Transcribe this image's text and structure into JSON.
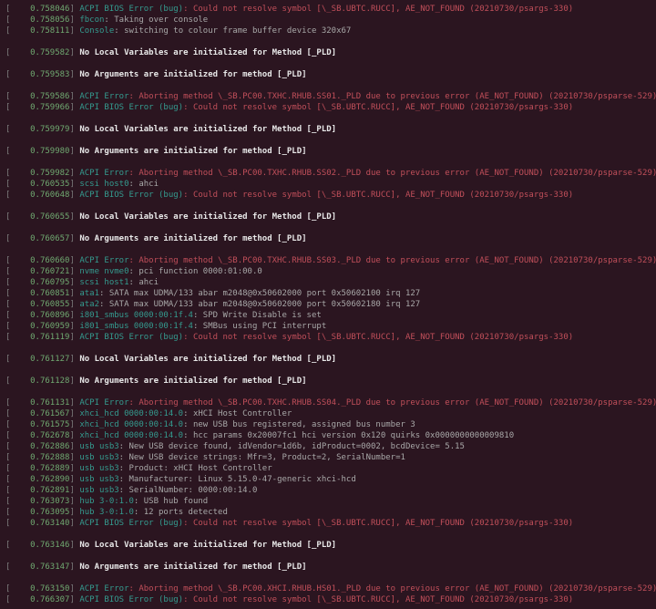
{
  "lines": [
    {
      "ts": "0.758046",
      "src": "ACPI BIOS Error (bug)",
      "err": ": Could not resolve symbol [\\_SB.UBTC.RUCC], AE_NOT_FOUND (20210730/psargs-330)"
    },
    {
      "ts": "0.758056",
      "src": "fbcon",
      "msg": ": Taking over console"
    },
    {
      "ts": "0.758111",
      "src": "Console",
      "msg": ": switching to colour frame buffer device 320x67"
    },
    {
      "blank": true
    },
    {
      "ts": "0.759582",
      "white": "No Local Variables are initialized for Method [_PLD]"
    },
    {
      "blank": true
    },
    {
      "ts": "0.759583",
      "white": "No Arguments are initialized for method [_PLD]"
    },
    {
      "blank": true
    },
    {
      "ts": "0.759586",
      "src": "ACPI Error",
      "err": ": Aborting method \\_SB.PC00.TXHC.RHUB.SS01._PLD due to previous error (AE_NOT_FOUND) (20210730/psparse-529)"
    },
    {
      "ts": "0.759966",
      "src": "ACPI BIOS Error (bug)",
      "err": ": Could not resolve symbol [\\_SB.UBTC.RUCC], AE_NOT_FOUND (20210730/psargs-330)"
    },
    {
      "blank": true
    },
    {
      "ts": "0.759979",
      "white": "No Local Variables are initialized for Method [_PLD]"
    },
    {
      "blank": true
    },
    {
      "ts": "0.759980",
      "white": "No Arguments are initialized for method [_PLD]"
    },
    {
      "blank": true
    },
    {
      "ts": "0.759982",
      "src": "ACPI Error",
      "err": ": Aborting method \\_SB.PC00.TXHC.RHUB.SS02._PLD due to previous error (AE_NOT_FOUND) (20210730/psparse-529)"
    },
    {
      "ts": "0.760535",
      "src": "scsi host0",
      "msg": ": ahci"
    },
    {
      "ts": "0.760648",
      "src": "ACPI BIOS Error (bug)",
      "err": ": Could not resolve symbol [\\_SB.UBTC.RUCC], AE_NOT_FOUND (20210730/psargs-330)"
    },
    {
      "blank": true
    },
    {
      "ts": "0.760655",
      "white": "No Local Variables are initialized for Method [_PLD]"
    },
    {
      "blank": true
    },
    {
      "ts": "0.760657",
      "white": "No Arguments are initialized for method [_PLD]"
    },
    {
      "blank": true
    },
    {
      "ts": "0.760660",
      "src": "ACPI Error",
      "err": ": Aborting method \\_SB.PC00.TXHC.RHUB.SS03._PLD due to previous error (AE_NOT_FOUND) (20210730/psparse-529)"
    },
    {
      "ts": "0.760721",
      "src": "nvme nvme0",
      "msg": ": pci function 0000:01:00.0"
    },
    {
      "ts": "0.760795",
      "src": "scsi host1",
      "msg": ": ahci"
    },
    {
      "ts": "0.760851",
      "src": "ata1",
      "msg": ": SATA max UDMA/133 abar m2048@0x50602000 port 0x50602100 irq 127"
    },
    {
      "ts": "0.760855",
      "src": "ata2",
      "msg": ": SATA max UDMA/133 abar m2048@0x50602000 port 0x50602180 irq 127"
    },
    {
      "ts": "0.760896",
      "src": "i801_smbus 0000:00:1f.4",
      "msg": ": SPD Write Disable is set"
    },
    {
      "ts": "0.760959",
      "src": "i801_smbus 0000:00:1f.4",
      "msg": ": SMBus using PCI interrupt"
    },
    {
      "ts": "0.761119",
      "src": "ACPI BIOS Error (bug)",
      "err": ": Could not resolve symbol [\\_SB.UBTC.RUCC], AE_NOT_FOUND (20210730/psargs-330)"
    },
    {
      "blank": true
    },
    {
      "ts": "0.761127",
      "white": "No Local Variables are initialized for Method [_PLD]"
    },
    {
      "blank": true
    },
    {
      "ts": "0.761128",
      "white": "No Arguments are initialized for method [_PLD]"
    },
    {
      "blank": true
    },
    {
      "ts": "0.761131",
      "src": "ACPI Error",
      "err": ": Aborting method \\_SB.PC00.TXHC.RHUB.SS04._PLD due to previous error (AE_NOT_FOUND) (20210730/psparse-529)"
    },
    {
      "ts": "0.761567",
      "src": "xhci_hcd 0000:00:14.0",
      "msg": ": xHCI Host Controller"
    },
    {
      "ts": "0.761575",
      "src": "xhci_hcd 0000:00:14.0",
      "msg": ": new USB bus registered, assigned bus number 3"
    },
    {
      "ts": "0.762678",
      "src": "xhci_hcd 0000:00:14.0",
      "msg": ": hcc params 0x20007fc1 hci version 0x120 quirks 0x0000000000009810"
    },
    {
      "ts": "0.762886",
      "src": "usb usb3",
      "msg": ": New USB device found, idVendor=1d6b, idProduct=0002, bcdDevice= 5.15"
    },
    {
      "ts": "0.762888",
      "src": "usb usb3",
      "msg": ": New USB device strings: Mfr=3, Product=2, SerialNumber=1"
    },
    {
      "ts": "0.762889",
      "src": "usb usb3",
      "msg": ": Product: xHCI Host Controller"
    },
    {
      "ts": "0.762890",
      "src": "usb usb3",
      "msg": ": Manufacturer: Linux 5.15.0-47-generic xhci-hcd"
    },
    {
      "ts": "0.762891",
      "src": "usb usb3",
      "msg": ": SerialNumber: 0000:00:14.0"
    },
    {
      "ts": "0.763073",
      "src": "hub 3-0:1.0",
      "msg": ": USB hub found"
    },
    {
      "ts": "0.763095",
      "src": "hub 3-0:1.0",
      "msg": ": 12 ports detected"
    },
    {
      "ts": "0.763140",
      "src": "ACPI BIOS Error (bug)",
      "err": ": Could not resolve symbol [\\_SB.UBTC.RUCC], AE_NOT_FOUND (20210730/psargs-330)"
    },
    {
      "blank": true
    },
    {
      "ts": "0.763146",
      "white": "No Local Variables are initialized for Method [_PLD]"
    },
    {
      "blank": true
    },
    {
      "ts": "0.763147",
      "white": "No Arguments are initialized for method [_PLD]"
    },
    {
      "blank": true
    },
    {
      "ts": "0.763150",
      "src": "ACPI Error",
      "err": ": Aborting method \\_SB.PC00.XHCI.RHUB.HS01._PLD due to previous error (AE_NOT_FOUND) (20210730/psparse-529)"
    },
    {
      "ts": "0.766307",
      "src": "ACPI BIOS Error (bug)",
      "err": ": Could not resolve symbol [\\_SB.UBTC.RUCC], AE_NOT_FOUND (20210730/psargs-330)"
    }
  ]
}
